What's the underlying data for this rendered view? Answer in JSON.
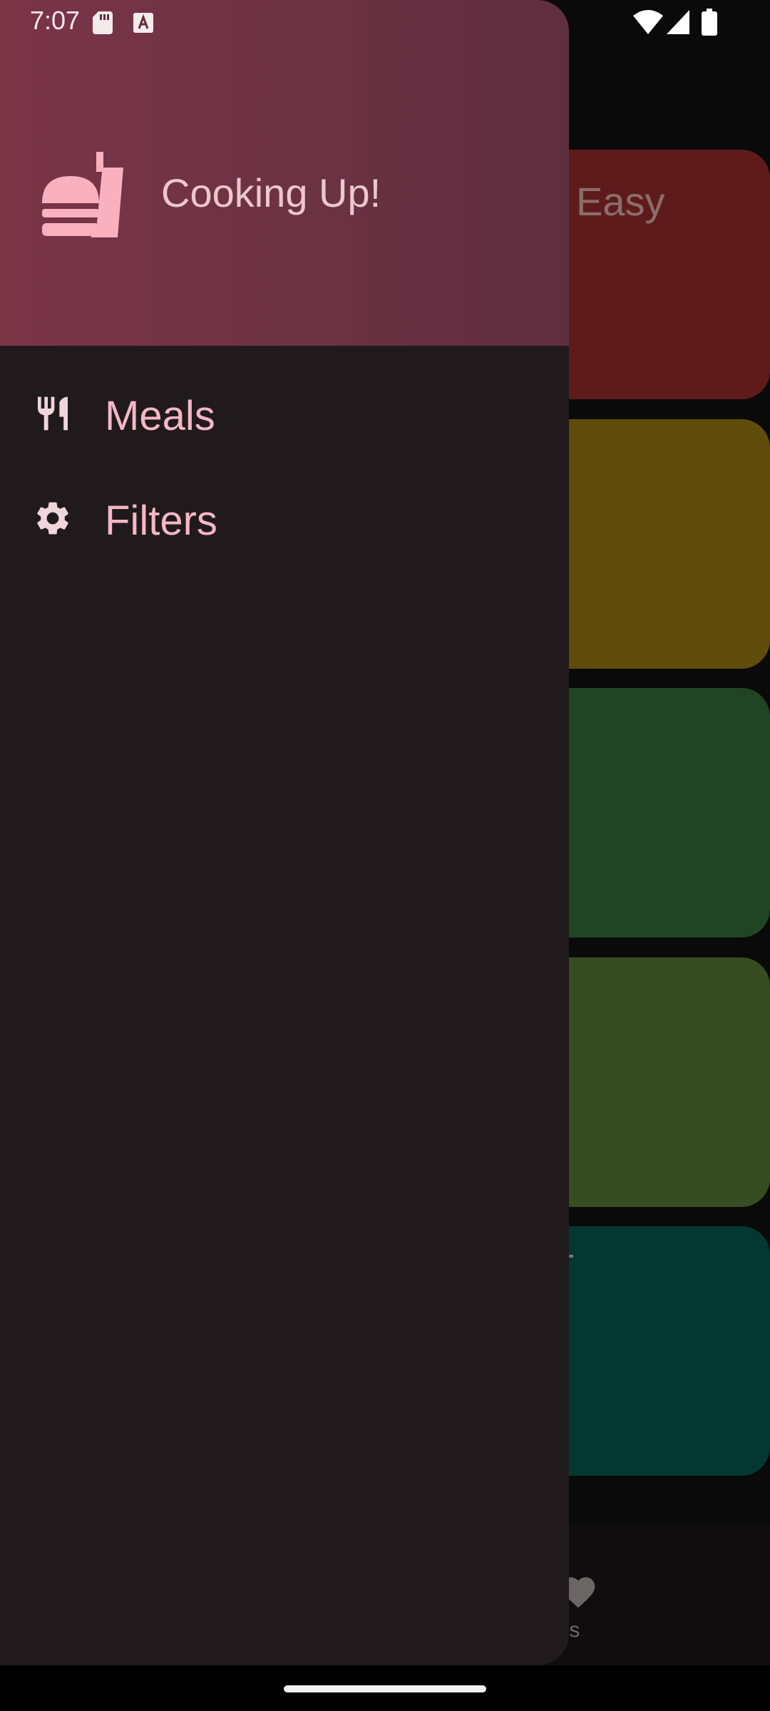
{
  "status_bar": {
    "time": "7:07",
    "icons": [
      "sd-card-icon",
      "a-notification-icon",
      "wifi-icon",
      "signal-icon",
      "battery-icon"
    ]
  },
  "background": {
    "visible_card_title": "Easy",
    "favorites_label_partial": "orites",
    "card_colors": [
      "#5f1b1b",
      "#5f4b0c",
      "#214524",
      "#384c21",
      "#023831"
    ]
  },
  "drawer": {
    "header_title": "Cooking Up!",
    "header_icon": "fastfood-icon",
    "items": [
      {
        "label": "Meals",
        "icon": "restaurant-icon"
      },
      {
        "label": "Filters",
        "icon": "settings-icon"
      }
    ]
  },
  "colors": {
    "drawer_bg": "#211a1c",
    "header_start": "#7a3547",
    "header_end": "#5f2f40",
    "accent_text": "#f4b7c6"
  }
}
